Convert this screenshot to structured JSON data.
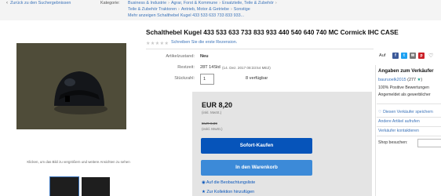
{
  "breadcrumb": {
    "back": "Zurück zu den Suchergebnissen",
    "category_label": "Kategorie:",
    "line1": [
      "Business & Industrie",
      "Agrar, Forst & Kommune",
      "Ersatzteile, Teile & Zubehör"
    ],
    "line2": [
      "Teile & Zubehör Traktoren",
      "Antrieb, Motor & Getriebe",
      "Sonstige"
    ],
    "line3": "Mehr anzeigen Schalthebel Kugel 433 533 633 733 833 933..."
  },
  "gallery": {
    "caption": "Klicken, um das Bild zu vergrößern und weitere Ansichten zu sehen"
  },
  "listing": {
    "title": "Schalthebel Kugel 433 533 633 733 833 933 440 540 640 740 MC Cormick IHC CASE",
    "review_link": "Schreiben Sie die erste Rezension.",
    "condition_label": "Artikelzustand:",
    "condition": "Neu",
    "remaining_label": "Restzeit:",
    "remaining": "28T 14Std",
    "remaining_date": "(14. Dez. 2017  08:33:54 MEZ)",
    "qty_label": "Stückzahl:",
    "qty": "1",
    "availability": "8 verfügbar",
    "share_label": "Auf"
  },
  "buybox": {
    "price": "EUR 8,20",
    "price_note": "(inkl. MwSt.)",
    "old_price": "EUR 8,89",
    "old_price_note": "(exkl. MwSt.)",
    "buy_now": "Sofort-Kaufen",
    "add_to_cart": "In den Warenkorb",
    "watchlist": "Auf die Beobachtungsliste",
    "collection": "Zur Kollektion hinzufügen"
  },
  "seller": {
    "title": "Angaben zum Verkäufer",
    "name": "bauruoelk2015",
    "feedback": "(277",
    "positive": "100% Positive Bewertungen",
    "registered": "Angemeldet als gewerblicher",
    "save": "Diesen Verkäufer speichern",
    "other_items": "Andere Artikel aufrufen",
    "contact": "Verkäufer kontaktieren",
    "shop_search": "Shop besuchen:"
  },
  "colors": {
    "link": "#3b73b9",
    "buy_button": "#0654ba",
    "cart_button": "#3c8ad8",
    "buybox_bg": "#e4e4e4"
  },
  "icons": {
    "share": [
      "facebook-icon",
      "twitter-icon",
      "email-icon",
      "pinterest-icon"
    ]
  }
}
